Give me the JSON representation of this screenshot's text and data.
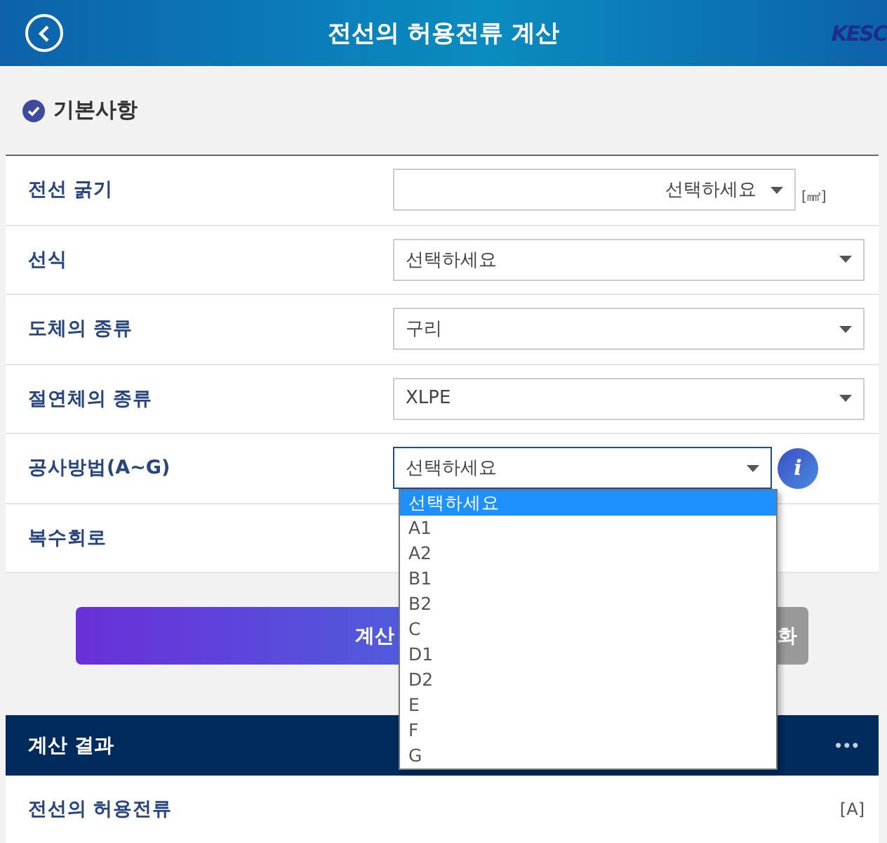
{
  "header": {
    "title": "전선의 허용전류 계산",
    "logo": "KESC"
  },
  "section": {
    "title": "기본사항"
  },
  "rows": [
    {
      "label": "전선 굵기",
      "value": "선택하세요",
      "unit": "[㎟]"
    },
    {
      "label": "선식",
      "value": "선택하세요"
    },
    {
      "label": "도체의 종류",
      "value": "구리"
    },
    {
      "label": "절연체의 종류",
      "value": "XLPE"
    },
    {
      "label": "공사방법(A~G)",
      "value": "선택하세요",
      "open": true,
      "info_text": "i",
      "options": [
        {
          "label": "선택하세요",
          "selected": true
        },
        {
          "label": "A1",
          "selected": false
        },
        {
          "label": "A2",
          "selected": false
        },
        {
          "label": "B1",
          "selected": false
        },
        {
          "label": "B2",
          "selected": false
        },
        {
          "label": "C",
          "selected": false
        },
        {
          "label": "D1",
          "selected": false
        },
        {
          "label": "D2",
          "selected": false
        },
        {
          "label": "E",
          "selected": false
        },
        {
          "label": "F",
          "selected": false
        },
        {
          "label": "G",
          "selected": false
        }
      ]
    },
    {
      "label": "복수회로"
    }
  ],
  "buttons": [
    {
      "kind": "primary",
      "label": "계산"
    },
    {
      "kind": "secondary",
      "label": "화"
    }
  ],
  "result": {
    "title": "계산 결과",
    "menu": "•••",
    "rows": [
      {
        "label": "전선의 허용전류",
        "unit": "[A]"
      }
    ]
  }
}
